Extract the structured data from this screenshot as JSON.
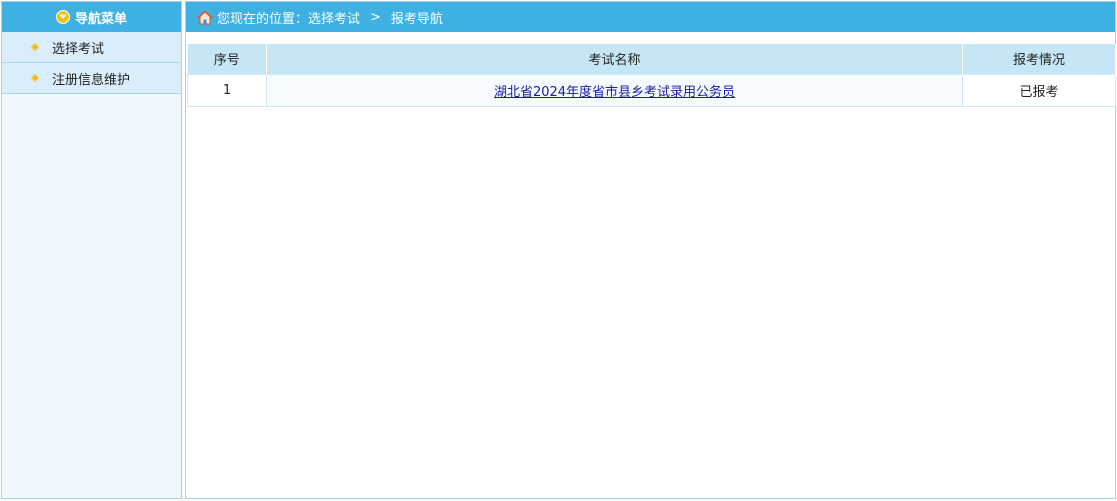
{
  "sidebar": {
    "title": "导航菜单",
    "items": [
      {
        "label": "选择考试"
      },
      {
        "label": "注册信息维护"
      }
    ]
  },
  "breadcrumb": {
    "prefix": "您现在的位置：选择考试",
    "separator": ">",
    "current": "报考导航"
  },
  "table": {
    "headers": [
      "序号",
      "考试名称",
      "报考情况"
    ],
    "rows": [
      {
        "index": "1",
        "name": "湖北省2024年度省市县乡考试录用公务员",
        "status": "已报考"
      }
    ]
  },
  "colors": {
    "header_blue": "#3eb0e2",
    "table_header": "#c5e7f5",
    "sidebar_bg": "#eef8fd",
    "menu_item_bg": "#d9eefa",
    "link": "#1a1aa6"
  },
  "icons": {
    "sidebar_header": "chevron-down-circle-icon",
    "menu_bullet": "diamond-bullet-icon",
    "breadcrumb": "home-icon"
  }
}
